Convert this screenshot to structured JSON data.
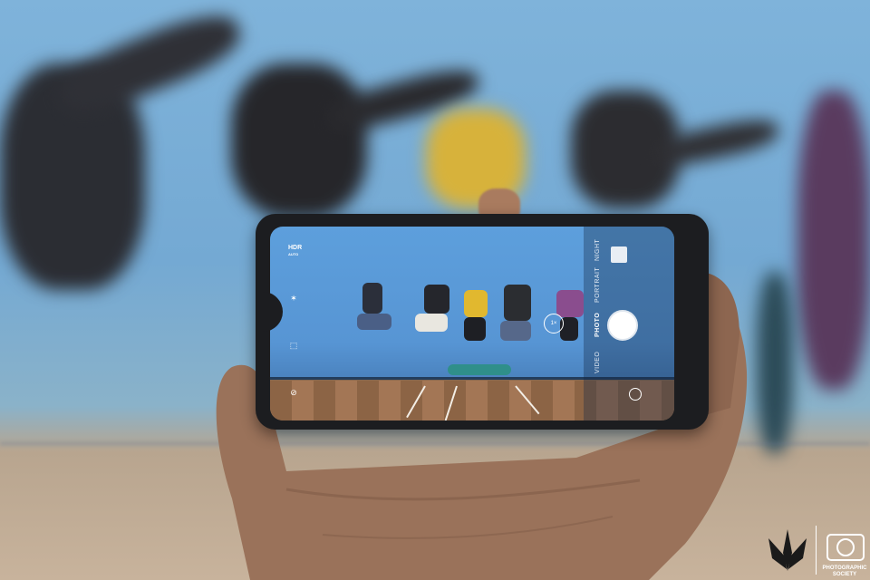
{
  "camera_ui": {
    "hdr_label": "HDR",
    "hdr_sub": "AUTO",
    "modes": [
      "NIGHT",
      "PORTRAIT",
      "PHOTO",
      "VIDEO"
    ],
    "zoom_label": "1×"
  },
  "watermark": {
    "org_line1": "PHOTOGRAPHIC",
    "org_line2": "SOCIETY"
  },
  "colors": {
    "wall": "#74a9d3",
    "screen_sky": "#5d9fdc",
    "floor": "#a37655",
    "phone_body": "#1c1d20"
  }
}
